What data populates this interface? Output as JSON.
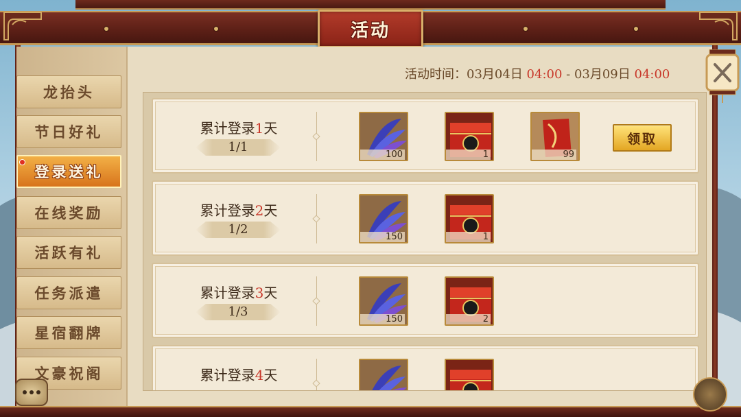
{
  "header": {
    "title": "活动"
  },
  "activity_time": {
    "label": "活动时间：",
    "start_date": "03月04日",
    "start_time": "04:00",
    "separator": " - ",
    "end_date": "03月09日",
    "end_time": "04:00"
  },
  "sidebar": {
    "items": [
      {
        "label": "龙抬头",
        "active": false
      },
      {
        "label": "节日好礼",
        "active": false
      },
      {
        "label": "登录送礼",
        "active": true
      },
      {
        "label": "在线奖励",
        "active": false
      },
      {
        "label": "活跃有礼",
        "active": false
      },
      {
        "label": "任务派遣",
        "active": false
      },
      {
        "label": "星宿翻牌",
        "active": false
      },
      {
        "label": "文豪祝阁",
        "active": false
      }
    ]
  },
  "rows": [
    {
      "title_prefix": "累计登录",
      "day": "1",
      "title_suffix": "天",
      "progress": "1/1",
      "rewards": [
        {
          "icon": "feather-icon",
          "count": "100"
        },
        {
          "icon": "red-chest-icon",
          "count": "1"
        },
        {
          "icon": "red-scroll-icon",
          "count": "99"
        }
      ],
      "button": "领取"
    },
    {
      "title_prefix": "累计登录",
      "day": "2",
      "title_suffix": "天",
      "progress": "1/2",
      "rewards": [
        {
          "icon": "feather-icon",
          "count": "150"
        },
        {
          "icon": "red-chest-icon",
          "count": "1"
        }
      ]
    },
    {
      "title_prefix": "累计登录",
      "day": "3",
      "title_suffix": "天",
      "progress": "1/3",
      "rewards": [
        {
          "icon": "feather-icon",
          "count": "150"
        },
        {
          "icon": "red-chest-icon",
          "count": "2"
        }
      ]
    },
    {
      "title_prefix": "累计登录",
      "day": "4",
      "title_suffix": "天",
      "progress": "",
      "rewards": [
        {
          "icon": "feather-icon",
          "count": ""
        },
        {
          "icon": "red-chest-icon",
          "count": ""
        }
      ]
    }
  ],
  "colors": {
    "accent_red": "#c8382a",
    "wood": "#5b1f16",
    "gold": "#c79a55",
    "active_tab": "#e8931f"
  }
}
